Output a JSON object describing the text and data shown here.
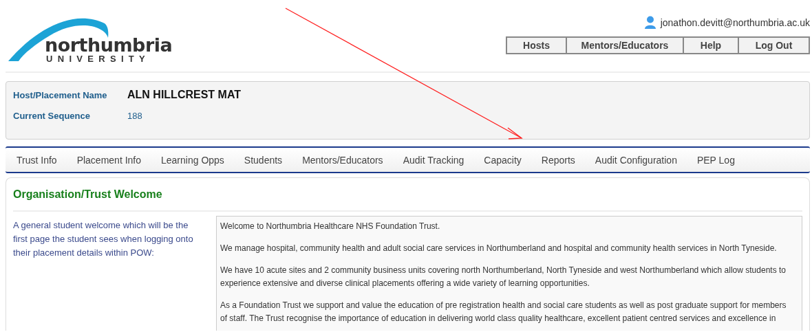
{
  "logo": {
    "wordmark": "northumbria",
    "subtitle": "UNIVERSITY"
  },
  "user": {
    "email": "jonathon.devitt@northumbria.ac.uk"
  },
  "nav_buttons": [
    "Hosts",
    "Mentors/Educators",
    "Help",
    "Log Out"
  ],
  "placement": {
    "fields": [
      {
        "label": "Host/Placement Name",
        "value": "ALN HILLCREST MAT",
        "kind": "title"
      },
      {
        "label": "Current Sequence",
        "value": "188",
        "kind": "plain"
      }
    ]
  },
  "tabs": [
    {
      "label": "Trust Info",
      "selected": false
    },
    {
      "label": "Placement Info",
      "selected": false
    },
    {
      "label": "Learning Opps",
      "selected": false
    },
    {
      "label": "Students",
      "selected": false
    },
    {
      "label": "Mentors/Educators",
      "selected": false
    },
    {
      "label": "Audit Tracking",
      "selected": false
    },
    {
      "label": "Capacity",
      "selected": false
    },
    {
      "label": "Reports",
      "selected": false
    },
    {
      "label": "Audit Configuration",
      "selected": false
    },
    {
      "label": "PEP Log",
      "selected": false
    }
  ],
  "welcome": {
    "heading": "Organisation/Trust Welcome",
    "description": "A general student welcome which will be the first page the student sees when logging onto their placement details within POW:",
    "paragraphs": [
      "Welcome to Northumbria Healthcare NHS Foundation Trust.",
      "We manage hospital, community health and adult social care services in Northumberland and hospital and community health services in North Tyneside.",
      "We have 10 acute sites and 2 community business units covering north Northumberland, North Tyneside and west Northumberland which allow students to experience extensive and diverse clinical placements offering a wide variety of learning opportunities.",
      "As a Foundation Trust we support and value the education of pre registration health and social care students as well as post graduate support for members of staff. The Trust recognise the importance of education in delivering world class quality healthcare, excellent patient centred services and excellence in"
    ]
  }
}
